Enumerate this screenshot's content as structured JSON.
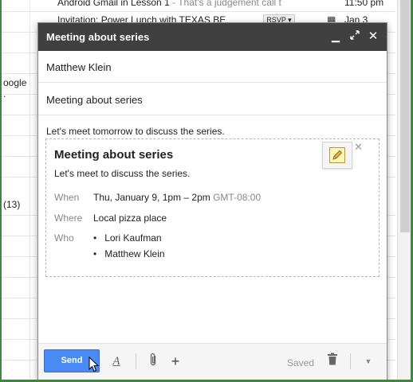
{
  "background": {
    "emails": [
      {
        "subject": "Android Gmail in Lesson 1",
        "snippet": " - That's a judgement call t",
        "time": "11:50 pm"
      },
      {
        "subject": "Invitation: Power Lunch with TEXAS BE",
        "rsvp": "RSVP ▾",
        "time": "Jan 3"
      }
    ],
    "left_fragments": [
      "oogle .",
      "(13)"
    ]
  },
  "compose": {
    "title": "Meeting about series",
    "to": "Matthew Klein",
    "subject": "Meeting about series",
    "body": "Let's meet tomorrow to discuss the series.",
    "invite": {
      "title": "Meeting about series",
      "description": "Let's meet to discuss the series.",
      "when_label": "When",
      "when_value": "Thu, January 9, 1pm – 2pm",
      "timezone": "GMT-08:00",
      "where_label": "Where",
      "where_value": "Local pizza place",
      "who_label": "Who",
      "guests": [
        "Lori Kaufman",
        "Matthew Klein"
      ]
    },
    "toolbar": {
      "send_label": "Send",
      "saved_label": "Saved",
      "format_glyph": "A"
    }
  },
  "colors": {
    "titlebar": "#404040",
    "send_button": "#4a8af4",
    "frame": "#3a8a3a"
  }
}
